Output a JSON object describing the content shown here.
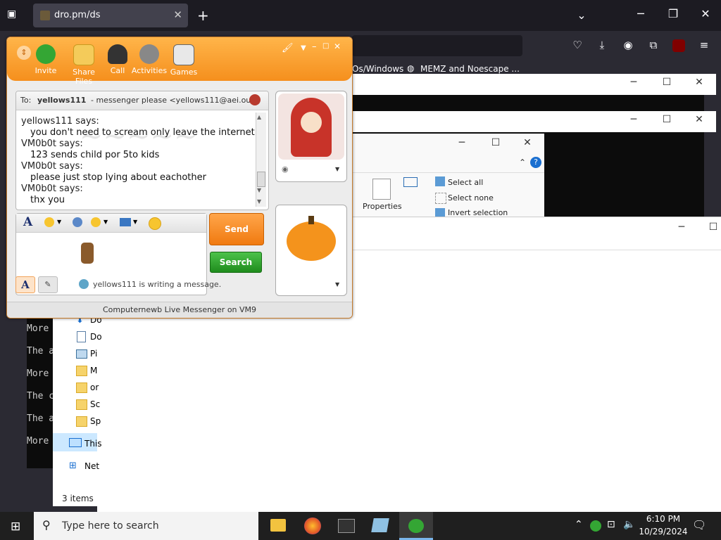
{
  "browser": {
    "tab_title": "dro.pm/ds",
    "bookmarks": [
      "Os/Windows",
      "MEMZ and Noescape ..."
    ]
  },
  "terminal_lines": [
    "More",
    "The a",
    "More",
    "The c",
    "The a",
    "More"
  ],
  "explorer": {
    "nav": [
      "Do",
      "Do",
      "Pi",
      "M",
      "or",
      "Sc",
      "Sp",
      "This",
      "Net"
    ],
    "status": "3 items",
    "ribbon": {
      "properties": "Properties",
      "select_all": "Select all",
      "select_none": "Select none",
      "invert_selection": "Invert selection"
    }
  },
  "messenger": {
    "toolbar": [
      "Invite",
      "Share Files",
      "Call",
      "Activities",
      "Games"
    ],
    "to_label": "To:",
    "contact_name": "yellows111",
    "contact_detail": "- messenger please <yellows111@aei.ou>",
    "messages": [
      {
        "sender": "yellows111 says:",
        "text": "you don't need to scream only leave the internet"
      },
      {
        "sender": "VM0b0t says:",
        "text": "123 sends child por 5to kids"
      },
      {
        "sender": "VM0b0t says:",
        "text": "please just stop lying about eachother"
      },
      {
        "sender": "VM0b0t says:",
        "text": "thx you"
      }
    ],
    "send_label": "Send",
    "search_label": "Search",
    "typing_status": "yellows111 is writing a message.",
    "footer": "Computernewb Live Messenger on VM9",
    "accent": "#f58f1d"
  },
  "taskbar": {
    "search_placeholder": "Type here to search",
    "time": "6:10 PM",
    "date": "10/29/2024"
  }
}
